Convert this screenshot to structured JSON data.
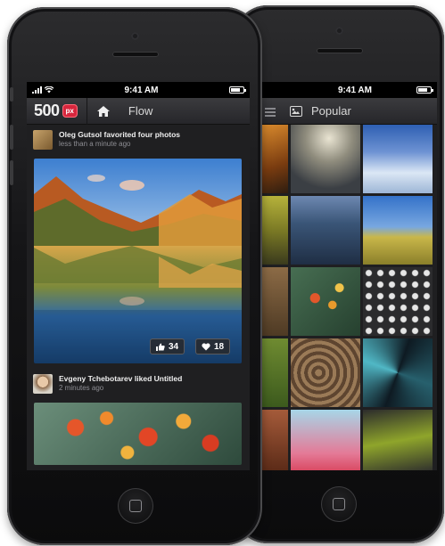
{
  "front": {
    "status": {
      "time": "9:41 AM"
    },
    "nav": {
      "logo": "500",
      "badge": "px",
      "title": "Flow"
    },
    "items": [
      {
        "author": "Oleg Gutsol",
        "action": "favorited four photos",
        "time": "less than a minute ago"
      },
      {
        "author": "Evgeny Tchebotarev",
        "action": "liked Untitled",
        "time": "2 minutes ago"
      }
    ],
    "likes": "34",
    "favorites": "18",
    "icons": {
      "home": "home-icon",
      "like": "thumbs-up-icon",
      "favorite": "heart-icon"
    }
  },
  "back": {
    "status": {
      "time": "9:41 AM"
    },
    "nav": {
      "title": "Popular"
    },
    "icons": {
      "menu": "list-icon",
      "popular": "photo-icon"
    }
  },
  "colors": {
    "accent": "#d7263d",
    "nav_bg": "#2f2f33",
    "screen_bg": "#1f1f21"
  }
}
